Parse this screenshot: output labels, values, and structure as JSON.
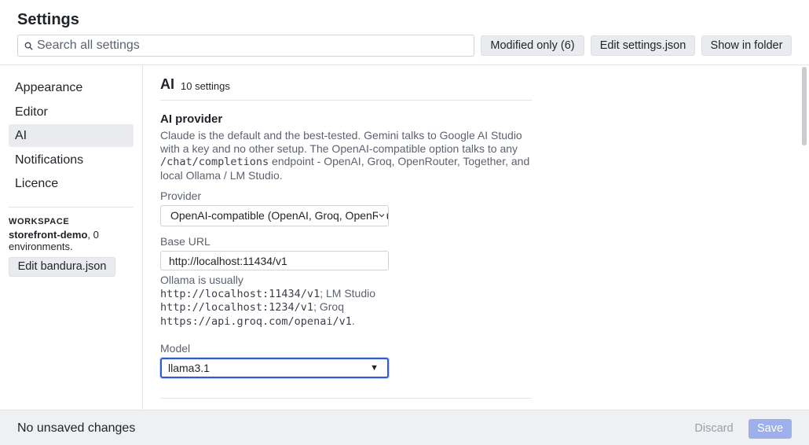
{
  "header": {
    "title": "Settings",
    "search_placeholder": "Search all settings",
    "modified_button": "Modified only (6)",
    "edit_settings_button": "Edit settings.json",
    "show_folder_button": "Show in folder"
  },
  "sidebar": {
    "items": [
      {
        "label": "Appearance",
        "active": false
      },
      {
        "label": "Editor",
        "active": false
      },
      {
        "label": "AI",
        "active": true
      },
      {
        "label": "Notifications",
        "active": false
      },
      {
        "label": "Licence",
        "active": false
      }
    ],
    "workspace_label": "WORKSPACE",
    "workspace_name": "storefront-demo",
    "workspace_suffix": ", 0 environments.",
    "edit_button": "Edit bandura.json"
  },
  "main": {
    "section_title": "AI",
    "section_count": "10 settings",
    "setting": {
      "title": "AI provider",
      "desc_1": "Claude is the default and the best-tested. Gemini talks to Google AI Studio with a key and no other setup. The OpenAI-compatible option talks to any ",
      "desc_code": "/chat/completions",
      "desc_2": " endpoint - OpenAI, Groq, OpenRouter, Together, and local Ollama / LM Studio."
    },
    "provider_label": "Provider",
    "provider_value": "OpenAI-compatible (OpenAI, Groq, OpenRouter",
    "base_url_label": "Base URL",
    "base_url_value": "http://localhost:11434/v1",
    "hint_1": "Ollama is usually ",
    "hint_code_1": "http://localhost:11434/v1",
    "hint_2": "; LM Studio ",
    "hint_code_2": "http://localhost:1234/v1",
    "hint_3": "; Groq ",
    "hint_code_3": "https://api.groq.com/openai/v1",
    "hint_4": ".",
    "model_label": "Model",
    "model_value": "llama3.1",
    "model_arrow": "▼"
  },
  "footer": {
    "status": "No unsaved changes",
    "discard": "Discard",
    "save": "Save"
  },
  "colors": {
    "accent": "#2f5bd8",
    "save_disabled": "#9db0ec",
    "active_nav": "#e9ebee"
  }
}
